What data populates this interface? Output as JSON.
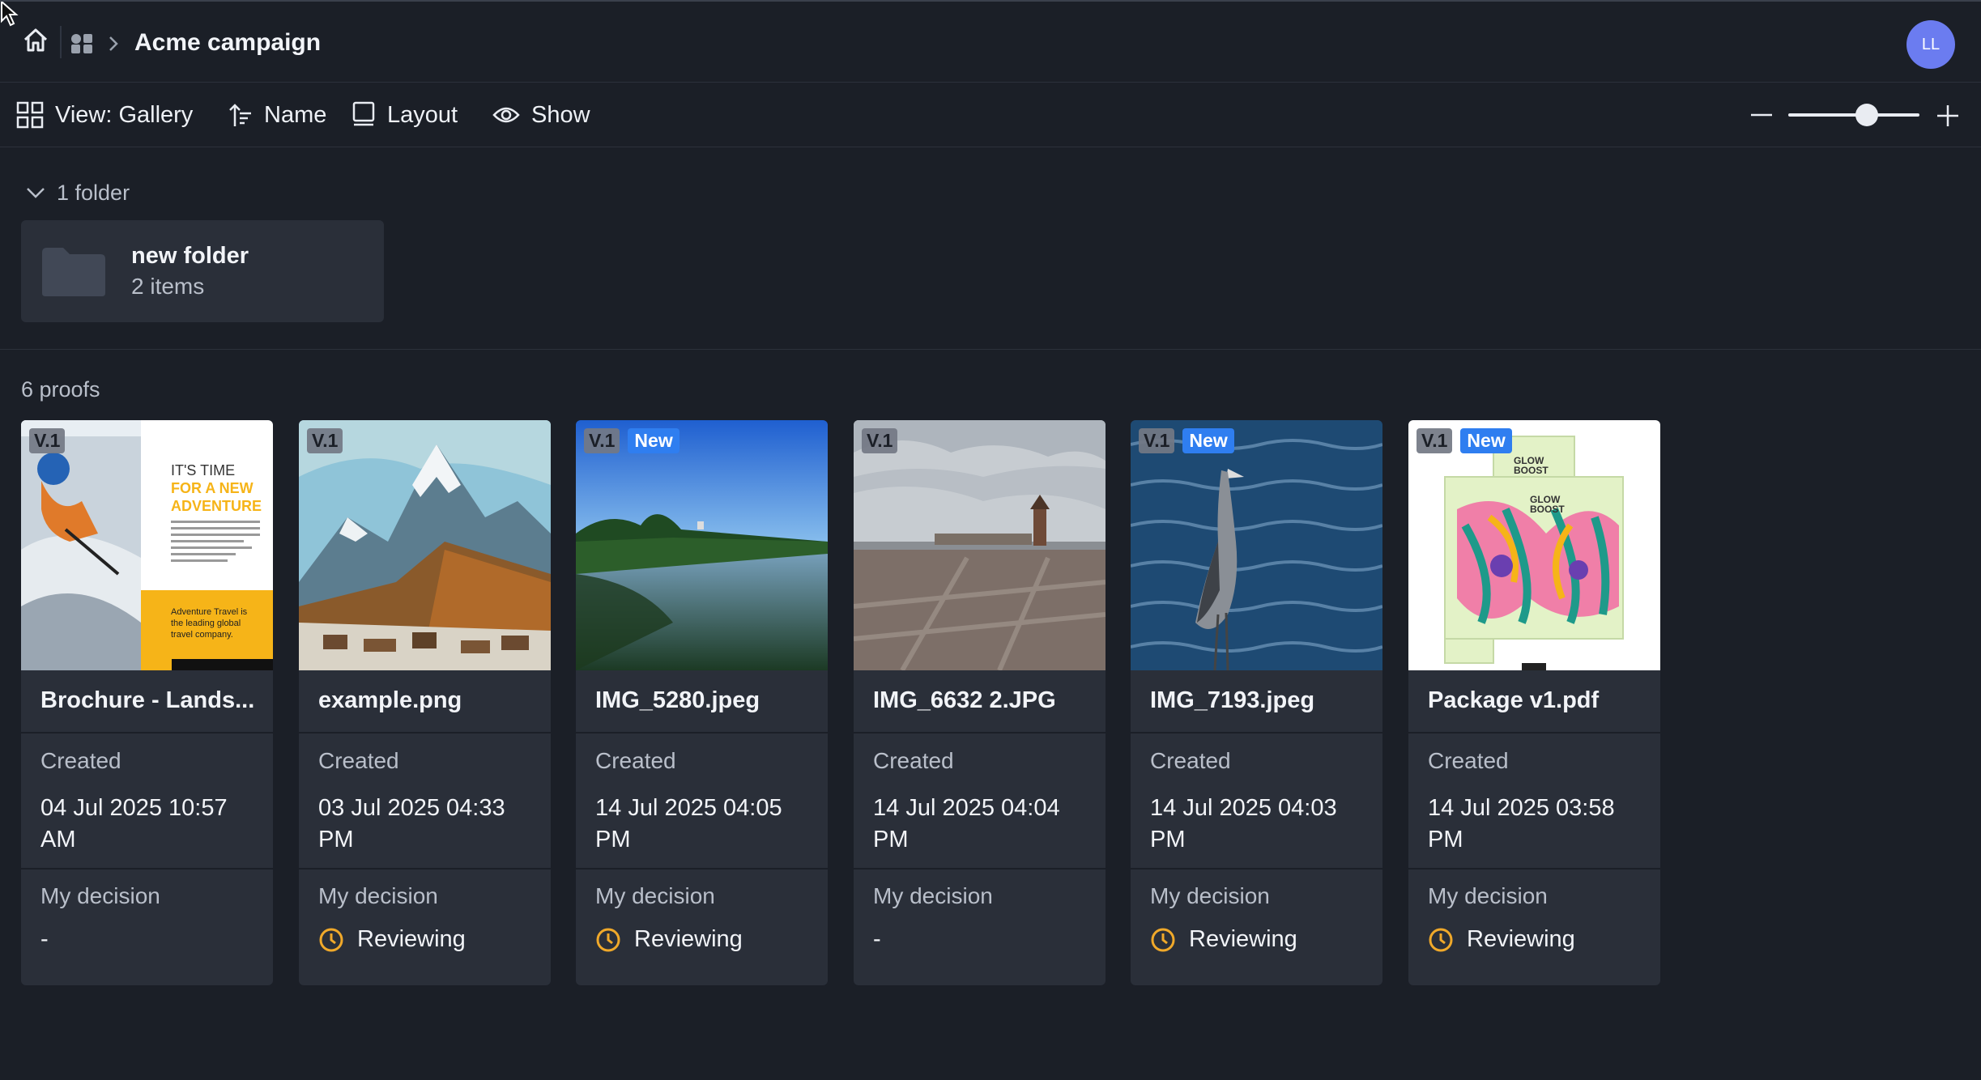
{
  "header": {
    "title": "Acme campaign",
    "avatar_initials": "LL",
    "avatar_color": "#6b7cf0"
  },
  "toolbar": {
    "view_label": "View: Gallery",
    "sort_label": "Name",
    "layout_label": "Layout",
    "show_label": "Show",
    "zoom_level": 0.6
  },
  "folders": {
    "count_label": "1 folder",
    "items": [
      {
        "name": "new folder",
        "count": "2 items"
      }
    ]
  },
  "proofs": {
    "count_label": "6 proofs",
    "created_label": "Created",
    "decision_label": "My decision",
    "items": [
      {
        "title": "Brochure - Lands...",
        "version": "V.1",
        "new": "",
        "created": "04 Jul 2025 10:57 AM",
        "decision": "-",
        "status_icon": ""
      },
      {
        "title": "example.png",
        "version": "V.1",
        "new": "",
        "created": "03 Jul 2025 04:33 PM",
        "decision": "Reviewing",
        "status_icon": "clock-icon"
      },
      {
        "title": "IMG_5280.jpeg",
        "version": "V.1",
        "new": "New",
        "created": "14 Jul 2025 04:05 PM",
        "decision": "Reviewing",
        "status_icon": "clock-icon"
      },
      {
        "title": "IMG_6632 2.JPG",
        "version": "V.1",
        "new": "",
        "created": "14 Jul 2025 04:04 PM",
        "decision": "-",
        "status_icon": ""
      },
      {
        "title": "IMG_7193.jpeg",
        "version": "V.1",
        "new": "New",
        "created": "14 Jul 2025 04:03 PM",
        "decision": "Reviewing",
        "status_icon": "clock-icon"
      },
      {
        "title": "Package v1.pdf",
        "version": "V.1",
        "new": "New",
        "created": "14 Jul 2025 03:58 PM",
        "decision": "Reviewing",
        "status_icon": "clock-icon"
      }
    ]
  },
  "thumbnails": {
    "brochure": {
      "heading": [
        "IT'S TIME",
        "FOR A NEW",
        "ADVENTURE"
      ],
      "footer": [
        "Adventure Travel is",
        "the leading global",
        "travel company."
      ]
    },
    "package": {
      "brand": [
        "GLOW",
        "BOOST"
      ]
    }
  },
  "colors": {
    "background": "#1b1f27",
    "card": "#2a2f39",
    "accent_new": "#2f7ef0",
    "reviewing": "#f0a92a",
    "accent_yellow": "#f6b418"
  }
}
